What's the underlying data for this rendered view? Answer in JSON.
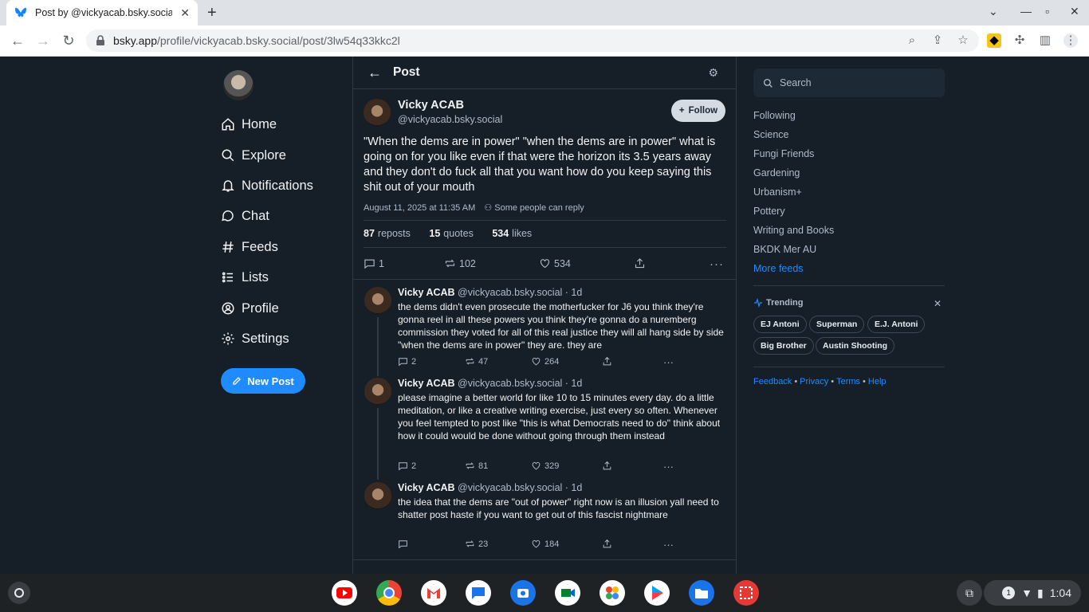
{
  "browser": {
    "tab_title": "Post by @vickyacab.bsky.social",
    "url_host": "bsky.app",
    "url_path": "/profile/vickyacab.bsky.social/post/3lw54q33kkc2l"
  },
  "nav": {
    "items": [
      "Home",
      "Explore",
      "Notifications",
      "Chat",
      "Feeds",
      "Lists",
      "Profile",
      "Settings"
    ],
    "new_post": "New Post"
  },
  "header": {
    "title": "Post"
  },
  "main_post": {
    "name": "Vicky ACAB",
    "handle": "@vickyacab.bsky.social",
    "follow_label": "Follow",
    "text": "\"When the dems are in power\" \"when the dems are in power\" what is going on for you like even if that were the horizon its 3.5 years away and they don't do fuck all that you want how do you keep saying this shit out of your mouth",
    "date": "August 11, 2025 at 11:35 AM",
    "reply_setting": "Some people can reply",
    "reposts_count": "87",
    "reposts_label": "reposts",
    "quotes_count": "15",
    "quotes_label": "quotes",
    "likes_count": "534",
    "likes_label": "likes",
    "replies": "1",
    "repost_num": "102",
    "like_num": "534"
  },
  "replies": [
    {
      "name": "Vicky ACAB",
      "handle": "@vickyacab.bsky.social · 1d",
      "text": "the dems didn't even prosecute the motherfucker for J6 you think they're gonna reel in all these powers you think they're gonna do a nuremberg commission they voted for all of this real justice they will all hang side by side \"when the dems are in power\" they are. they are",
      "replies": "2",
      "reposts": "47",
      "likes": "264"
    },
    {
      "name": "Vicky ACAB",
      "handle": "@vickyacab.bsky.social · 1d",
      "text": "please imagine a better world for like 10 to 15 minutes every day. do a little meditation, or like a creative writing exercise, just every so often. Whenever you feel tempted to post like \"this is what Democrats need to do\" think about how it could would be done without going through them instead",
      "replies": "2",
      "reposts": "81",
      "likes": "329"
    },
    {
      "name": "Vicky ACAB",
      "handle": "@vickyacab.bsky.social · 1d",
      "text": "the idea that the dems are \"out of power\" right now is an illusion yall need to shatter post haste if you want to get out of this fascist nightmare",
      "replies": "",
      "reposts": "23",
      "likes": "184"
    }
  ],
  "sidebar": {
    "search_placeholder": "Search",
    "feeds": [
      "Following",
      "Science",
      "Fungi Friends",
      "Gardening",
      "Urbanism+",
      "Pottery",
      "Writing and Books",
      "BKDK Mer AU"
    ],
    "more_feeds": "More feeds",
    "trending_title": "Trending",
    "trending": [
      "EJ Antoni",
      "Superman",
      "E.J. Antoni",
      "Big Brother",
      "Austin Shooting"
    ],
    "footer": [
      "Feedback",
      "Privacy",
      "Terms",
      "Help"
    ]
  },
  "shelf": {
    "time": "1:04",
    "notification_count": "1"
  },
  "colors": {
    "accent": "#208bfe",
    "background": "#161e27"
  }
}
